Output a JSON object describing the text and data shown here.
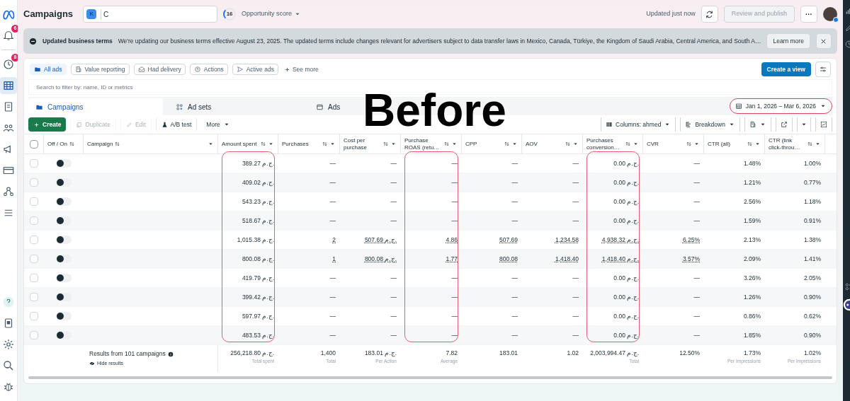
{
  "nav": {
    "top": [
      {
        "kind": "logo",
        "selected": false
      },
      {
        "kind": "bell",
        "badge": "6",
        "selected": false
      },
      {
        "kind": "clock",
        "badge": "8",
        "selected": false
      },
      {
        "kind": "table",
        "selected": true
      },
      {
        "kind": "pages",
        "selected": false
      },
      {
        "kind": "people",
        "selected": false
      },
      {
        "kind": "megaphone",
        "selected": false
      },
      {
        "kind": "card",
        "selected": false
      },
      {
        "kind": "network",
        "selected": false
      },
      {
        "kind": "menu",
        "selected": false
      }
    ],
    "bottom": [
      {
        "kind": "help",
        "selected": false
      },
      {
        "kind": "doc",
        "selected": false
      },
      {
        "kind": "gear",
        "selected": false
      },
      {
        "kind": "search",
        "selected": false
      },
      {
        "kind": "bug",
        "selected": false
      }
    ]
  },
  "header": {
    "title": "Campaigns",
    "account_badge": "K",
    "account_name": "C",
    "score": "16",
    "score_label": "Opportunity score",
    "updated": "Updated just now",
    "review_button": {
      "label": "Review and publish",
      "disabled": true
    },
    "more_button": "···"
  },
  "banner": {
    "title": "Updated business terms",
    "message": "We're updating our business terms effective August 23, 2025. The updated terms include changes relevant for advertisers subject to data transfer laws in Mexico, Canada, Türkiye, the Kingdom of Saudi Arabia, Central America, and South A…",
    "action": "Learn more"
  },
  "filter_chips": [
    {
      "label": "All ads",
      "kind": "folder",
      "selected": true
    },
    {
      "label": "Value reporting",
      "kind": "report",
      "selected": false
    },
    {
      "label": "Had delivery",
      "kind": "mail",
      "selected": false
    },
    {
      "label": "Actions",
      "kind": "target",
      "selected": false
    },
    {
      "label": "Active ads",
      "kind": "send",
      "selected": false
    }
  ],
  "see_more": "See more",
  "create_view": "Create a view",
  "search": {
    "placeholder": "Search to filter by: name, ID or metrics"
  },
  "tabs": [
    {
      "label": "Campaigns",
      "kind": "folder",
      "selected": true
    },
    {
      "label": "Ad sets",
      "kind": "grid",
      "selected": false
    },
    {
      "label": "Ads",
      "kind": "window",
      "selected": false
    }
  ],
  "date_range": {
    "label": "Jan 1, 2026 – Mar 6, 2026",
    "highlighted": true
  },
  "overlay_caption": "Before",
  "toolbar": {
    "left": [
      {
        "label": "Create",
        "kind": "create",
        "disabled": false
      },
      {
        "label": "Duplicate",
        "kind": "copy",
        "disabled": true
      },
      {
        "label": "Edit",
        "kind": "pencil",
        "disabled": true
      },
      {
        "label": "A/B test",
        "kind": "flask",
        "disabled": false
      },
      {
        "label": "More",
        "kind": "more",
        "disabled": false
      }
    ],
    "columns": "Columns: ahmed",
    "breakdown": "Breakdown"
  },
  "table": {
    "select_all_checked": false,
    "columns": [
      {
        "label": "Off / On",
        "highlighted": false
      },
      {
        "label": "Campaign",
        "highlighted": false
      },
      {
        "label": "Amount spent",
        "highlighted": true
      },
      {
        "label": "Purchases",
        "highlighted": false
      },
      {
        "label": "Cost per purchase",
        "highlighted": false
      },
      {
        "label": "Purchase ROAS (retu…",
        "highlighted": true
      },
      {
        "label": "CPP",
        "highlighted": false
      },
      {
        "label": "AOV",
        "highlighted": false
      },
      {
        "label": "Purchases conversion…",
        "highlighted": true
      },
      {
        "label": "CVR",
        "highlighted": false
      },
      {
        "label": "CTR (all)",
        "highlighted": false
      },
      {
        "label": "CTR (link click-throu…",
        "highlighted": false
      }
    ],
    "rows": [
      {
        "checked": false,
        "on": false,
        "cells": [
          {
            "text": "389.27 ج.م.",
            "underlined": false
          },
          {
            "text": "—",
            "underlined": false
          },
          {
            "text": "—",
            "underlined": false
          },
          {
            "text": "—",
            "underlined": false
          },
          {
            "text": "—",
            "underlined": false
          },
          {
            "text": "—",
            "underlined": false
          },
          {
            "text": "0.00 ج.م.",
            "underlined": false
          },
          {
            "text": "—",
            "underlined": false
          },
          {
            "text": "1.48%",
            "underlined": false
          },
          {
            "text": "1.00%",
            "underlined": false
          }
        ]
      },
      {
        "checked": false,
        "on": false,
        "cells": [
          {
            "text": "409.02 ج.م.",
            "underlined": false
          },
          {
            "text": "—",
            "underlined": false
          },
          {
            "text": "—",
            "underlined": false
          },
          {
            "text": "—",
            "underlined": false
          },
          {
            "text": "—",
            "underlined": false
          },
          {
            "text": "—",
            "underlined": false
          },
          {
            "text": "0.00 ج.م.",
            "underlined": false
          },
          {
            "text": "—",
            "underlined": false
          },
          {
            "text": "1.21%",
            "underlined": false
          },
          {
            "text": "0.77%",
            "underlined": false
          }
        ]
      },
      {
        "checked": false,
        "on": false,
        "cells": [
          {
            "text": "543.23 ج.م.",
            "underlined": false
          },
          {
            "text": "—",
            "underlined": false
          },
          {
            "text": "—",
            "underlined": false
          },
          {
            "text": "—",
            "underlined": false
          },
          {
            "text": "—",
            "underlined": false
          },
          {
            "text": "—",
            "underlined": false
          },
          {
            "text": "0.00 ج.م.",
            "underlined": false
          },
          {
            "text": "—",
            "underlined": false
          },
          {
            "text": "2.56%",
            "underlined": false
          },
          {
            "text": "1.18%",
            "underlined": false
          }
        ]
      },
      {
        "checked": false,
        "on": false,
        "cells": [
          {
            "text": "518.67 ج.م.",
            "underlined": false
          },
          {
            "text": "—",
            "underlined": false
          },
          {
            "text": "—",
            "underlined": false
          },
          {
            "text": "—",
            "underlined": false
          },
          {
            "text": "—",
            "underlined": false
          },
          {
            "text": "—",
            "underlined": false
          },
          {
            "text": "0.00 ج.م.",
            "underlined": false
          },
          {
            "text": "—",
            "underlined": false
          },
          {
            "text": "1.59%",
            "underlined": false
          },
          {
            "text": "0.91%",
            "underlined": false
          }
        ]
      },
      {
        "checked": false,
        "on": false,
        "cells": [
          {
            "text": "1,015.38 ج.م.",
            "underlined": false
          },
          {
            "text": "2",
            "underlined": true
          },
          {
            "text": "507.69 ج.م.",
            "underlined": true
          },
          {
            "text": "4.86",
            "underlined": true
          },
          {
            "text": "507.69",
            "underlined": true
          },
          {
            "text": "1,234.58",
            "underlined": true
          },
          {
            "text": "4,938.32 ج.م.",
            "underlined": true
          },
          {
            "text": "6.25%",
            "underlined": true
          },
          {
            "text": "2.13%",
            "underlined": false
          },
          {
            "text": "1.38%",
            "underlined": false
          }
        ]
      },
      {
        "checked": false,
        "on": false,
        "cells": [
          {
            "text": "800.08 ج.م.",
            "underlined": false
          },
          {
            "text": "1",
            "underlined": true
          },
          {
            "text": "800.08 ج.م.",
            "underlined": true
          },
          {
            "text": "1.77",
            "underlined": true
          },
          {
            "text": "800.08",
            "underlined": true
          },
          {
            "text": "1,418.40",
            "underlined": true
          },
          {
            "text": "1,418.40 ج.م.",
            "underlined": true
          },
          {
            "text": "3.57%",
            "underlined": true
          },
          {
            "text": "2.09%",
            "underlined": false
          },
          {
            "text": "1.41%",
            "underlined": false
          }
        ]
      },
      {
        "checked": false,
        "on": false,
        "cells": [
          {
            "text": "419.79 ج.م.",
            "underlined": false
          },
          {
            "text": "—",
            "underlined": false
          },
          {
            "text": "—",
            "underlined": false
          },
          {
            "text": "—",
            "underlined": false
          },
          {
            "text": "—",
            "underlined": false
          },
          {
            "text": "—",
            "underlined": false
          },
          {
            "text": "0.00 ج.م.",
            "underlined": false
          },
          {
            "text": "—",
            "underlined": false
          },
          {
            "text": "3.26%",
            "underlined": false
          },
          {
            "text": "2.05%",
            "underlined": false
          }
        ]
      },
      {
        "checked": false,
        "on": false,
        "cells": [
          {
            "text": "399.42 ج.م.",
            "underlined": false
          },
          {
            "text": "—",
            "underlined": false
          },
          {
            "text": "—",
            "underlined": false
          },
          {
            "text": "—",
            "underlined": false
          },
          {
            "text": "—",
            "underlined": false
          },
          {
            "text": "—",
            "underlined": false
          },
          {
            "text": "0.00 ج.م.",
            "underlined": false
          },
          {
            "text": "—",
            "underlined": false
          },
          {
            "text": "1.26%",
            "underlined": false
          },
          {
            "text": "0.90%",
            "underlined": false
          }
        ]
      },
      {
        "checked": false,
        "on": false,
        "cells": [
          {
            "text": "597.97 ج.م.",
            "underlined": false
          },
          {
            "text": "—",
            "underlined": false
          },
          {
            "text": "—",
            "underlined": false
          },
          {
            "text": "—",
            "underlined": false
          },
          {
            "text": "—",
            "underlined": false
          },
          {
            "text": "—",
            "underlined": false
          },
          {
            "text": "0.00 ج.م.",
            "underlined": false
          },
          {
            "text": "—",
            "underlined": false
          },
          {
            "text": "0.86%",
            "underlined": false
          },
          {
            "text": "0.62%",
            "underlined": false
          }
        ]
      },
      {
        "checked": false,
        "on": false,
        "cells": [
          {
            "text": "483.53 ج.م.",
            "underlined": false
          },
          {
            "text": "—",
            "underlined": false
          },
          {
            "text": "—",
            "underlined": false
          },
          {
            "text": "—",
            "underlined": false
          },
          {
            "text": "—",
            "underlined": false
          },
          {
            "text": "—",
            "underlined": false
          },
          {
            "text": "0.00 ج.م.",
            "underlined": false
          },
          {
            "text": "—",
            "underlined": false
          },
          {
            "text": "1.85%",
            "underlined": false
          },
          {
            "text": "0.90%",
            "underlined": false
          }
        ]
      }
    ],
    "summary": {
      "label": "Results from 101 campaigns",
      "hide": "Hide results",
      "totals": [
        {
          "value": "256,218.80 ج.م.",
          "note": "Total spent"
        },
        {
          "value": "1,400",
          "note": "Total"
        },
        {
          "value": "183.01 ج.م.",
          "note": "Per Action"
        },
        {
          "value": "7.82",
          "note": "Average"
        },
        {
          "value": "183.01"
        },
        {
          "value": "1.02"
        },
        {
          "value": "2,003,994.47 ج.م.",
          "note": "Total"
        },
        {
          "value": "12.50%"
        },
        {
          "value": "1.73%",
          "note": "Per Impressions"
        },
        {
          "value": "1.02%",
          "note": "Per Impressions"
        }
      ]
    }
  },
  "right_rail": [
    {
      "kind": "chart"
    },
    {
      "kind": "pencil"
    },
    {
      "kind": "clock"
    },
    {
      "kind": "grid"
    },
    {
      "kind": "bot"
    }
  ]
}
